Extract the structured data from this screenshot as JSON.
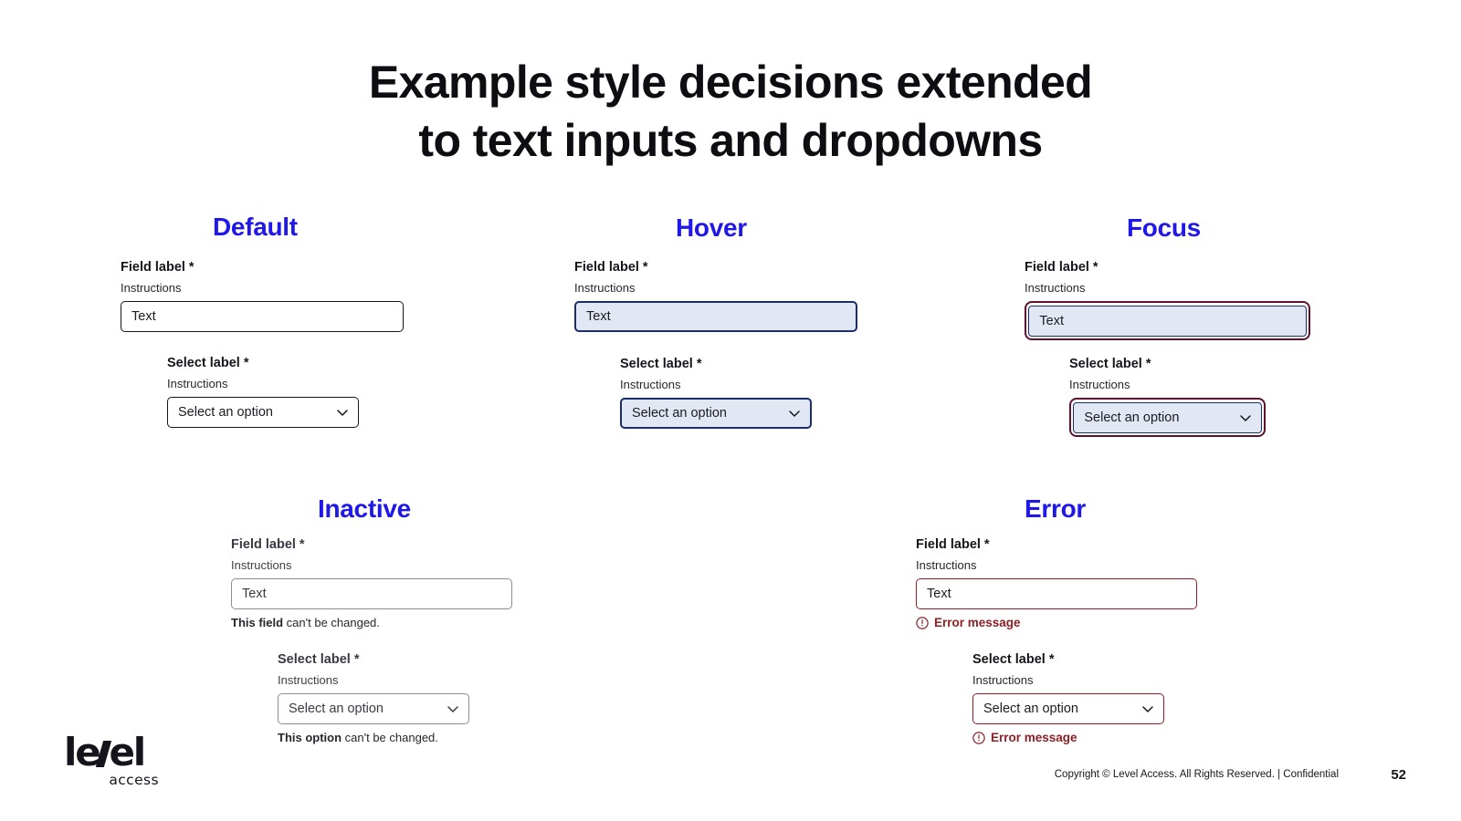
{
  "slide": {
    "title_line1": "Example style decisions extended",
    "title_line2": "to text inputs and dropdowns",
    "accent_color": "#2018e8",
    "title_color": "#0d0d12"
  },
  "sections": {
    "default": {
      "heading": "Default",
      "text_field": {
        "label": "Field label *",
        "instructions": "Instructions",
        "value": "Text"
      },
      "select_field": {
        "label": "Select label *",
        "instructions": "Instructions",
        "value": "Select an option",
        "chevron_icon": "chevron-down-icon"
      }
    },
    "hover": {
      "heading": "Hover",
      "fill_color": "#e2e7f4",
      "border_color": "#1a2e6e",
      "text_field": {
        "label": "Field label *",
        "instructions": "Instructions",
        "value": "Text"
      },
      "select_field": {
        "label": "Select label *",
        "instructions": "Instructions",
        "value": "Select an option",
        "chevron_icon": "chevron-down-icon"
      }
    },
    "focus": {
      "heading": "Focus",
      "ring_color": "#5d1030",
      "fill_color": "#e2e7f4",
      "border_color": "#1a2e6e",
      "text_field": {
        "label": "Field label *",
        "instructions": "Instructions",
        "value": "Text"
      },
      "select_field": {
        "label": "Select label *",
        "instructions": "Instructions",
        "value": "Select an option",
        "chevron_icon": "chevron-down-icon"
      }
    },
    "inactive": {
      "heading": "Inactive",
      "border_color": "#8c8c96",
      "text_field": {
        "label": "Field label *",
        "instructions": "Instructions",
        "value": "Text",
        "helper_bold": "This field",
        "helper_rest": " can't be changed."
      },
      "select_field": {
        "label": "Select label *",
        "instructions": "Instructions",
        "value": "Select an option",
        "chevron_icon": "chevron-down-icon",
        "helper_bold": "This option",
        "helper_rest": " can't be changed."
      }
    },
    "error": {
      "heading": "Error",
      "border_color": "#8c2026",
      "message_color": "#8c2026",
      "text_field": {
        "label": "Field label *",
        "instructions": "Instructions",
        "value": "Text",
        "error_message": "Error message",
        "error_icon": "exclamation-circle-icon"
      },
      "select_field": {
        "label": "Select label *",
        "instructions": "Instructions",
        "value": "Select an option",
        "chevron_icon": "chevron-down-icon",
        "error_message": "Error message",
        "error_icon": "exclamation-circle-icon"
      }
    }
  },
  "branding": {
    "logo_part1": "le",
    "logo_part2": "el",
    "logo_sub": "access"
  },
  "footer": {
    "copyright": "Copyright © Level Access. All Rights Reserved. | Confidential",
    "page_number": "52"
  }
}
